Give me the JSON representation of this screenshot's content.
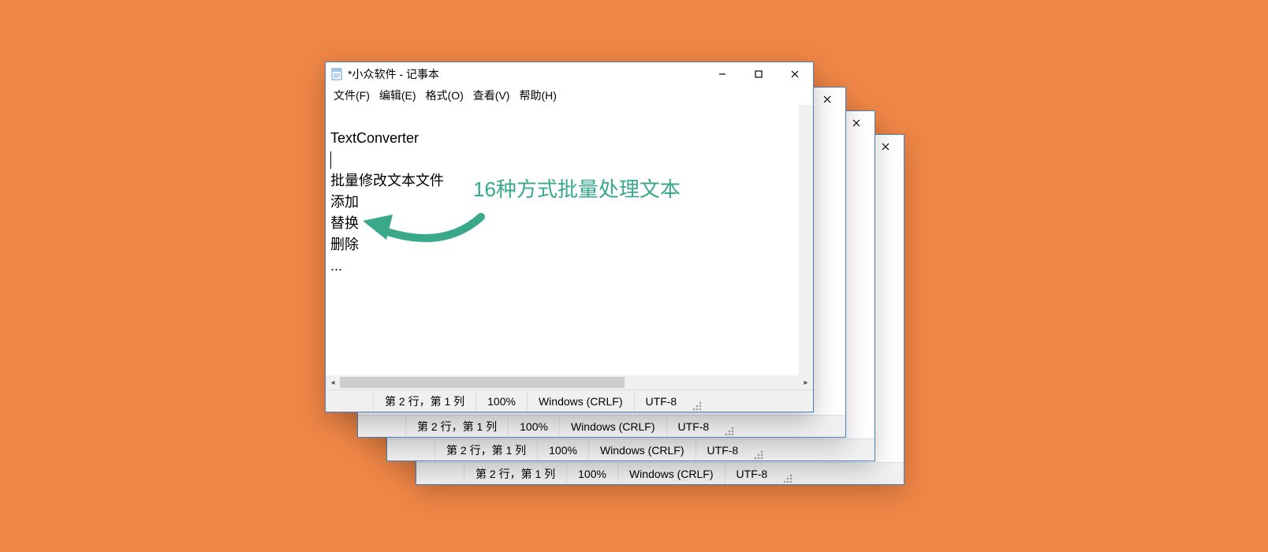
{
  "window": {
    "title": "*小众软件 - 记事本",
    "menus": {
      "file": "文件(F)",
      "edit": "编辑(E)",
      "format": "格式(O)",
      "view": "查看(V)",
      "help": "帮助(H)"
    },
    "editor_lines": [
      "TextConverter",
      "",
      "批量修改文本文件",
      "添加",
      "替换",
      "删除",
      "..."
    ],
    "status": {
      "position": "第 2 行，第 1 列",
      "zoom": "100%",
      "line_ending": "Windows (CRLF)",
      "encoding": "UTF-8"
    }
  },
  "annotation": {
    "text": "16种方式批量处理文本"
  },
  "colors": {
    "background": "#ef8646",
    "accent": "#3aa98b",
    "window_border": "#4a7dbf"
  }
}
